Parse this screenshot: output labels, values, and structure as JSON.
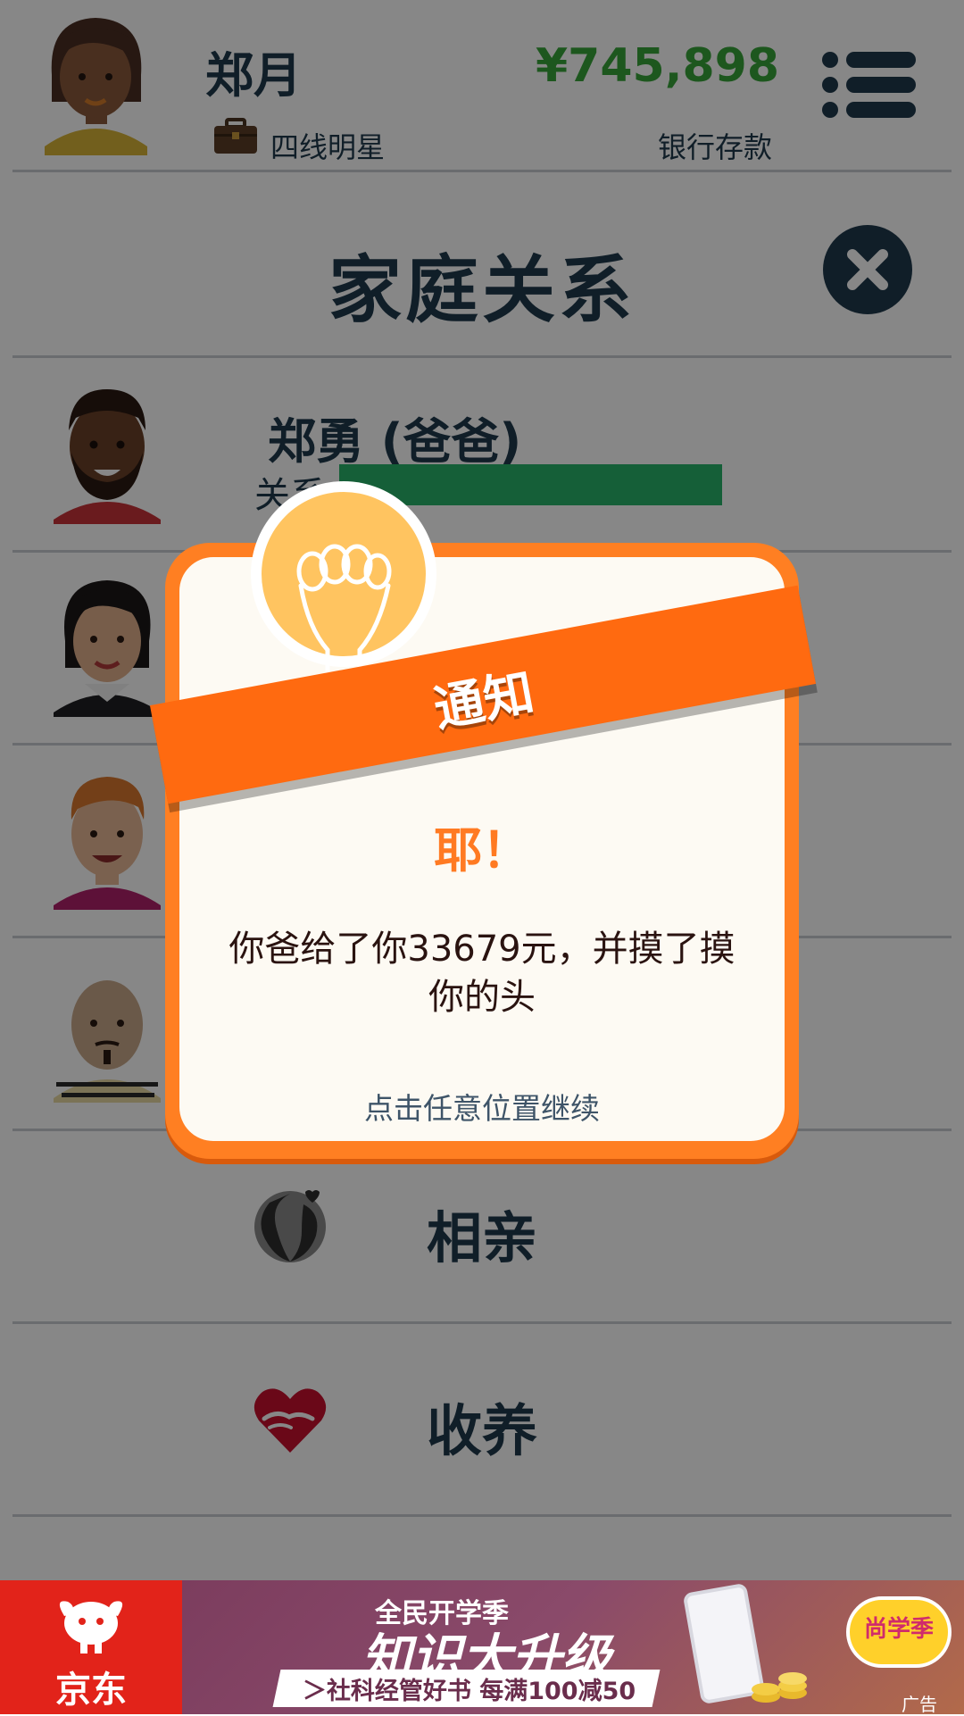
{
  "player": {
    "name": "郑月",
    "career": "四线明星",
    "money": "¥745,898",
    "money_label": "银行存款"
  },
  "section": {
    "title": "家庭关系"
  },
  "family": [
    {
      "name": "郑勇 (爸爸)",
      "relationship_label": "关系",
      "relationship_level": 0.8
    }
  ],
  "actions": {
    "dating": "相亲",
    "adopt": "收养"
  },
  "notification": {
    "banner": "通知",
    "heading": "耶！",
    "message": "你爸给了你33679元，并摸了摸你的头",
    "continue_hint": "点击任意位置继续"
  },
  "ad": {
    "brand": "京东",
    "line1": "全民开学季",
    "line2": "知识大升级",
    "promo": "＞社科经管好书 每满100减50",
    "badge": "尚学季",
    "tag": "广告"
  },
  "colors": {
    "primary_dark": "#1f3a4d",
    "money_green": "#37a43a",
    "relationship_bar": "#28b36a",
    "popup_orange": "#ff7f22",
    "banner_orange": "#ff6a10",
    "brand_red": "#e2231a"
  },
  "icons": {
    "menu": "list-menu-icon",
    "close": "close-icon",
    "briefcase": "briefcase-icon",
    "bulb": "lightbulb-icon",
    "dating": "couple-kiss-icon",
    "adopt": "heart-hands-icon"
  }
}
